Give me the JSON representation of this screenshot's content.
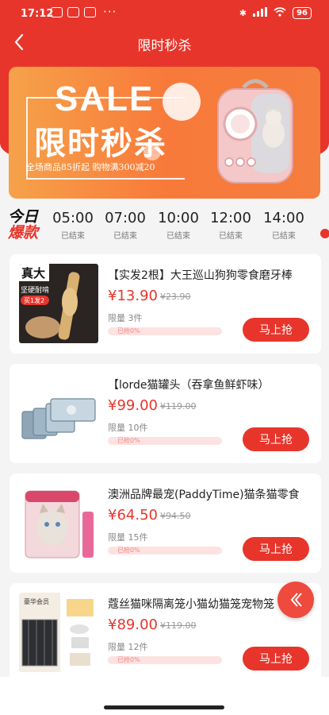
{
  "status": {
    "time": "17:12",
    "dots": "···",
    "battery": "96",
    "signal": "4G"
  },
  "nav": {
    "title": "限时秒杀"
  },
  "banner": {
    "sale": "SALE",
    "headline": "限时秒杀",
    "subline": "全场商品85折起 购物满300减20"
  },
  "timebar": {
    "today_line1": "今日",
    "today_line2": "爆款",
    "slots": [
      {
        "time": "05:00",
        "status": "已结束"
      },
      {
        "time": "07:00",
        "status": "已结束"
      },
      {
        "time": "10:00",
        "status": "已结束"
      },
      {
        "time": "12:00",
        "status": "已结束"
      },
      {
        "time": "14:00",
        "status": "已结束"
      }
    ]
  },
  "products": [
    {
      "title": "【实发2根】大王巡山狗狗零食磨牙棒",
      "price": "¥13.90",
      "original": "¥23.90",
      "limit": "限量 3件",
      "progress_label": "已抢0%",
      "progress": 0,
      "buy": "马上抢",
      "img_text1": "真大",
      "img_text2": "坚硬耐啃",
      "img_text3": "买1发2"
    },
    {
      "title": "【lorde猫罐头（吞拿鱼鲜虾味）",
      "price": "¥99.00",
      "original": "¥119.00",
      "limit": "限量 10件",
      "progress_label": "已抢0%",
      "progress": 0,
      "buy": "马上抢"
    },
    {
      "title": "澳洲品牌最宠(PaddyTime)猫条猫零食",
      "price": "¥64.50",
      "original": "¥94.50",
      "limit": "限量 15件",
      "progress_label": "已抢0%",
      "progress": 0,
      "buy": "马上抢"
    },
    {
      "title": "蔻丝猫咪隔离笼小猫幼猫笼宠物笼",
      "price": "¥89.00",
      "original": "¥119.00",
      "limit": "限量 12件",
      "progress_label": "已抢0%",
      "progress": 0,
      "buy": "马上抢",
      "img_text1": "豪华会员"
    }
  ],
  "colors": {
    "accent": "#e8352b",
    "banner_orange": "#f87a3a"
  }
}
